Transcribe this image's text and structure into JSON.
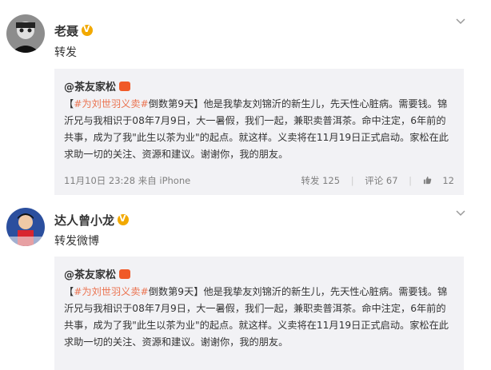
{
  "posts": [
    {
      "username": "老聂",
      "repost_text": "转发",
      "quote": {
        "author": "@茶友家松",
        "hashtag": "#为刘世羽义卖#",
        "tag_suffix": "倒数第9天",
        "body": "他是我挚友刘锦沂的新生儿，先天性心脏病。需要钱。锦沂兄与我相识于08年7月9日，大一暑假，我们一起，兼职卖普洱茶。命中注定，6年前的共事，成为了我\"此生以茶为业\"的起点。就这样。义卖将在11月19日正式启动。家松在此求助一切的关注、资源和建议。谢谢你，我的朋友。",
        "timestamp": "11月10日 23:28 来自 iPhone",
        "repost_label": "转发 125",
        "comment_label": "评论 67",
        "like_label": "12"
      }
    },
    {
      "username": "达人曾小龙",
      "repost_text": "转发微博",
      "quote": {
        "author": "@茶友家松",
        "hashtag": "#为刘世羽义卖#",
        "tag_suffix": "倒数第9天",
        "body": "他是我挚友刘锦沂的新生儿，先天性心脏病。需要钱。锦沂兄与我相识于08年7月9日，大一暑假，我们一起，兼职卖普洱茶。命中注定，6年前的共事，成为了我\"此生以茶为业\"的起点。就这样。义卖将在11月19日正式启动。家松在此求助一切的关注、资源和建议。谢谢你，我的朋友。"
      }
    }
  ],
  "icons": {
    "more": "chevron-down-icon",
    "like": "thumbs-up-icon"
  },
  "colors": {
    "hashtag": "#eb7350",
    "verified": "#f2a900",
    "quote_bg": "#f2f2f5"
  }
}
